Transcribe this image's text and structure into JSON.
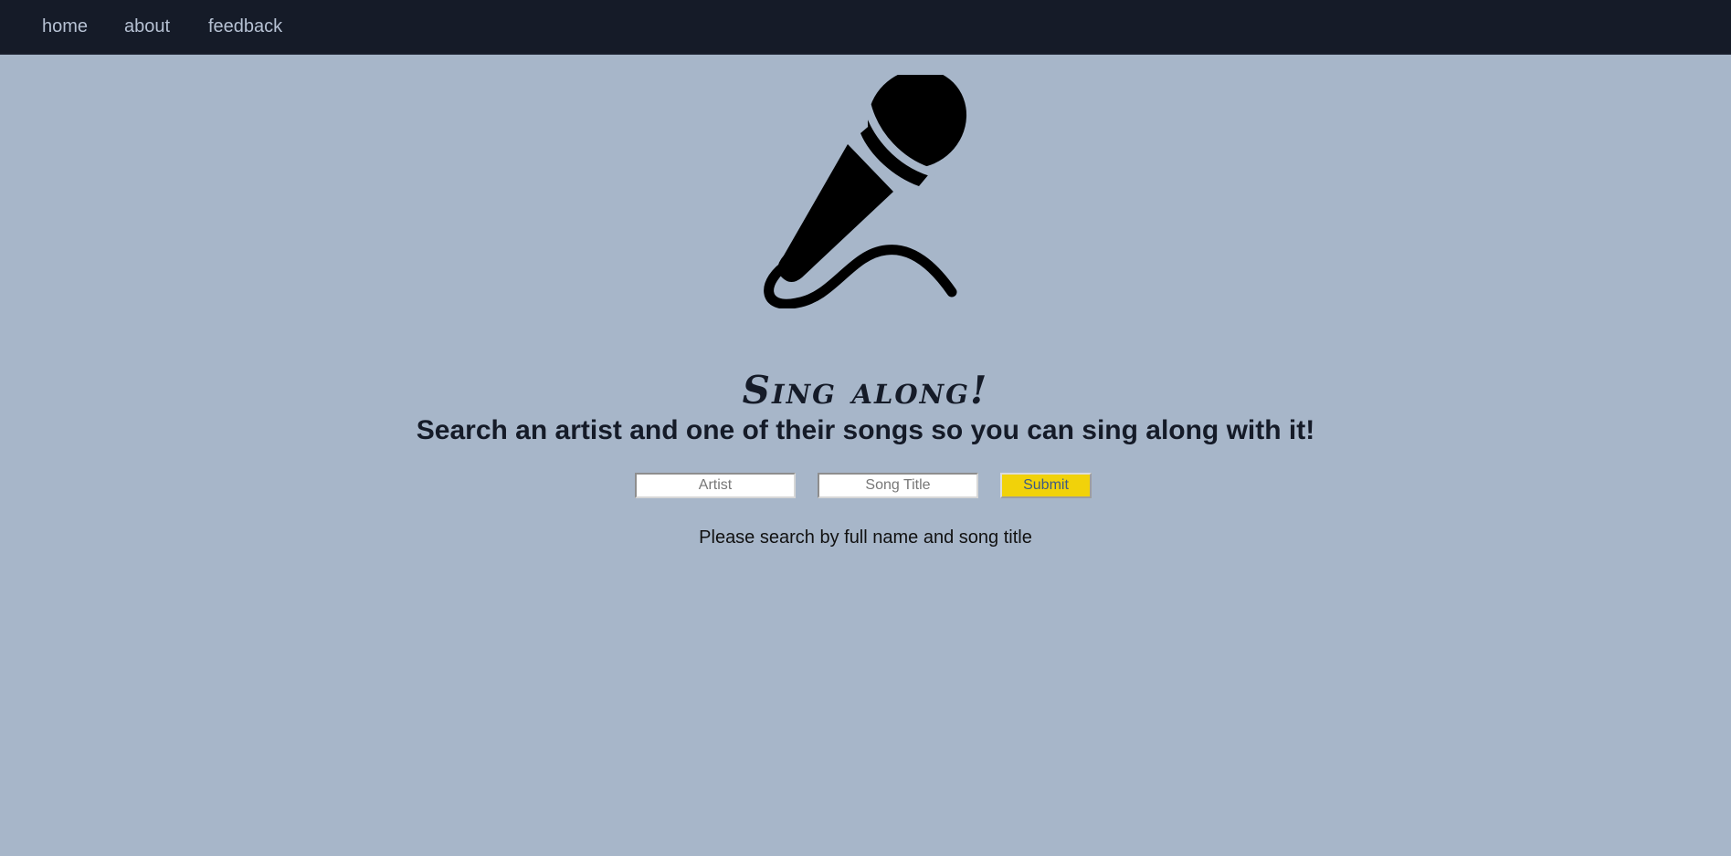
{
  "nav": {
    "items": [
      {
        "label": "home"
      },
      {
        "label": "about"
      },
      {
        "label": "feedback"
      }
    ]
  },
  "hero": {
    "icon": "microphone-icon",
    "title": "Sing along!",
    "subtitle": "Search an artist and one of their songs so you can sing along with it!"
  },
  "search": {
    "artist_placeholder": "Artist",
    "artist_value": "",
    "song_placeholder": "Song Title",
    "song_value": "",
    "submit_label": "Submit",
    "hint": "Please search by full name and song title"
  },
  "colors": {
    "background": "#a7b6c9",
    "navbar": "#151b28",
    "nav_text": "#b6c1d3",
    "submit_bg": "#f1d20a",
    "submit_text": "#3d5a85"
  }
}
